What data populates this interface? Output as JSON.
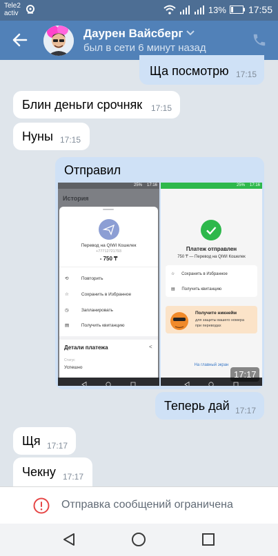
{
  "status_bar": {
    "carrier_line1": "Tele2",
    "carrier_line2": "activ",
    "battery_percent": "13%",
    "time": "17:55",
    "icons": [
      "location-pin-icon",
      "wifi-icon",
      "signal-icon",
      "signal-icon",
      "battery-icon"
    ]
  },
  "header": {
    "contact_name": "Даурен Вайсберг",
    "last_seen": "был в сети 6 минут назад",
    "icons": [
      "back-arrow-icon",
      "chevron-down-icon",
      "phone-icon"
    ]
  },
  "messages": [
    {
      "dir": "out",
      "text": "Ща посмотрю",
      "time": "17:15"
    },
    {
      "dir": "in",
      "text": "Блин деньги срочняк",
      "time": "17:15"
    },
    {
      "dir": "in",
      "text": "Нуны",
      "time": "17:15"
    },
    {
      "dir": "out",
      "text": "Отправил",
      "time": "17:17",
      "has_attachments": true
    },
    {
      "dir": "out",
      "text": "Теперь дай",
      "time": "17:17"
    },
    {
      "dir": "in",
      "text": "Щя",
      "time": "17:17"
    },
    {
      "dir": "in",
      "text": "Чекну",
      "time": "17:17"
    }
  ],
  "attachment1": {
    "status_time": "17:16",
    "status_batt": "25%",
    "title": "История",
    "transfer_title": "Перевод на QIWI Кошелек",
    "phone": "+77712721793",
    "amount": "- 750 ₸",
    "menu": [
      "Повторить",
      "Сохранить в Избранное",
      "Запланировать",
      "Получить квитанцию"
    ],
    "details_title": "Детали платежа",
    "status_label": "Статус",
    "status_value": "Успешно"
  },
  "attachment2": {
    "status_time": "17:16",
    "status_batt": "25%",
    "title": "Платеж отправлен",
    "subtitle": "750 ₸ — Перевод на QIWI Кошелек",
    "menu": [
      "Сохранить в Избранное",
      "Получить квитанцию"
    ],
    "promo_title": "Получите никнейм",
    "promo_line1": "для защиты вашего номера",
    "promo_line2": "при переводах",
    "link": "На главный экран"
  },
  "footer": {
    "restriction_text": "Отправка сообщений ограничена",
    "icons": [
      "exclamation-circle-icon"
    ]
  },
  "nav_bar": {
    "icons": [
      "back-triangle-icon",
      "home-circle-icon",
      "recents-square-icon"
    ]
  },
  "colors": {
    "header": "#5181b8",
    "status_bar": "#4d6e94",
    "chat_bg": "#dfe5eb",
    "incoming_bubble": "#ffffff",
    "outgoing_bubble": "#cfe1f6",
    "time_text": "#818c99",
    "qiwi_green": "#2db84b",
    "warning_red": "#e64646"
  }
}
